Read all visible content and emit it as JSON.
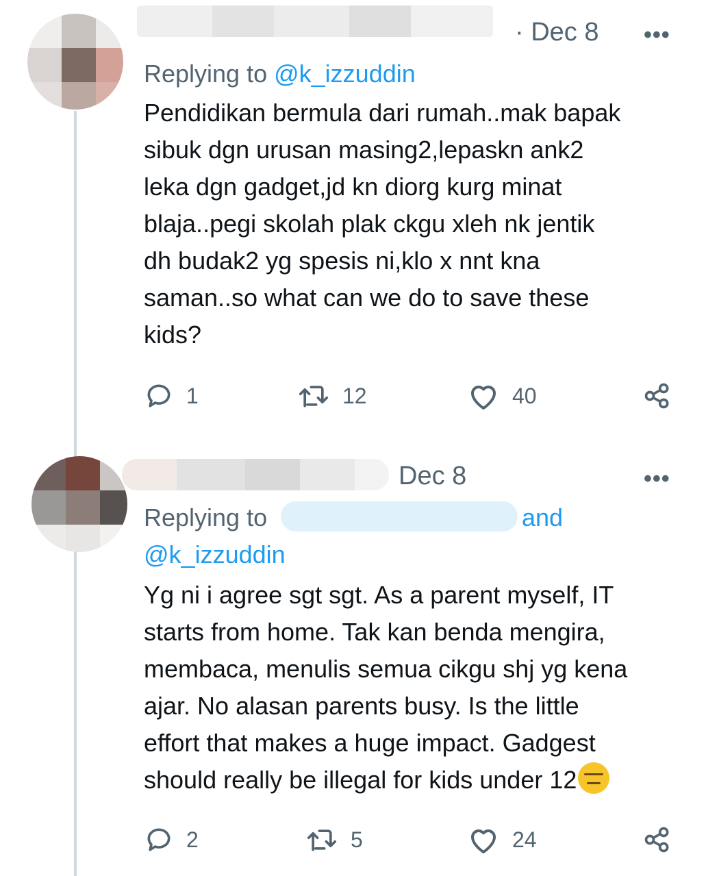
{
  "tweets": [
    {
      "date": "· Dec 8",
      "more": "•••",
      "replying_prefix": "Replying to ",
      "replying_handle": "@k_izzuddin",
      "body": "Pendidikan bermula dari rumah..mak bapak\nsibuk dgn urusan masing2,lepaskn ank2\nleka dgn gadget,jd kn diorg kurg minat\nblaja..pegi skolah plak ckgu xleh nk jentik\ndh budak2 yg spesis ni,klo x nnt kna\nsaman..so what can we do to save these\nkids?",
      "replies": "1",
      "retweets": "12",
      "likes": "40",
      "icons": {
        "reply": "reply-icon",
        "retweet": "retweet-icon",
        "like": "heart-icon",
        "share": "share-icon"
      }
    },
    {
      "date": "Dec 8",
      "more": "•••",
      "replying_prefix": "Replying to",
      "replying_and": "and",
      "replying_handle": "@k_izzuddin",
      "body": "Yg ni i agree sgt sgt. As a parent myself, IT\nstarts from home. Tak kan benda mengira,\nmembaca, menulis semua cikgu shj yg kena\najar. No alasan parents busy. Is the little\neffort that makes a huge impact. Gadgest\nshould really be illegal for kids under 12",
      "emoji": "expressionless-face-emoji",
      "replies": "2",
      "retweets": "5",
      "likes": "24",
      "icons": {
        "reply": "reply-icon",
        "retweet": "retweet-icon",
        "like": "heart-icon",
        "share": "share-icon"
      }
    }
  ],
  "colors": {
    "text": "#0f1419",
    "muted": "#536471",
    "accent": "#1d9bf0",
    "thread_line": "#cfd9de"
  }
}
